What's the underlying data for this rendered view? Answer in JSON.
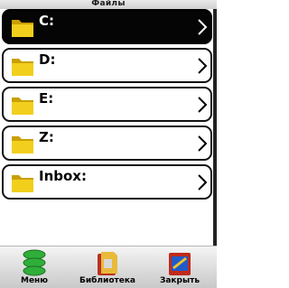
{
  "window": {
    "title": "Файлы"
  },
  "drives": [
    {
      "label": "C:",
      "selected": true
    },
    {
      "label": "D:",
      "selected": false
    },
    {
      "label": "E:",
      "selected": false
    },
    {
      "label": "Z:",
      "selected": false
    },
    {
      "label": "Inbox:",
      "selected": false
    }
  ],
  "icons": {
    "drive": "folder-icon",
    "open": "chevron-right-icon"
  },
  "softkeys": {
    "menu_label": "Меню",
    "library_label": "Библиотека",
    "close_label": "Закрыть"
  },
  "colors": {
    "selected_row": "#050505",
    "folder": "#e8c00c",
    "menu_icon": "#2fae3a"
  }
}
